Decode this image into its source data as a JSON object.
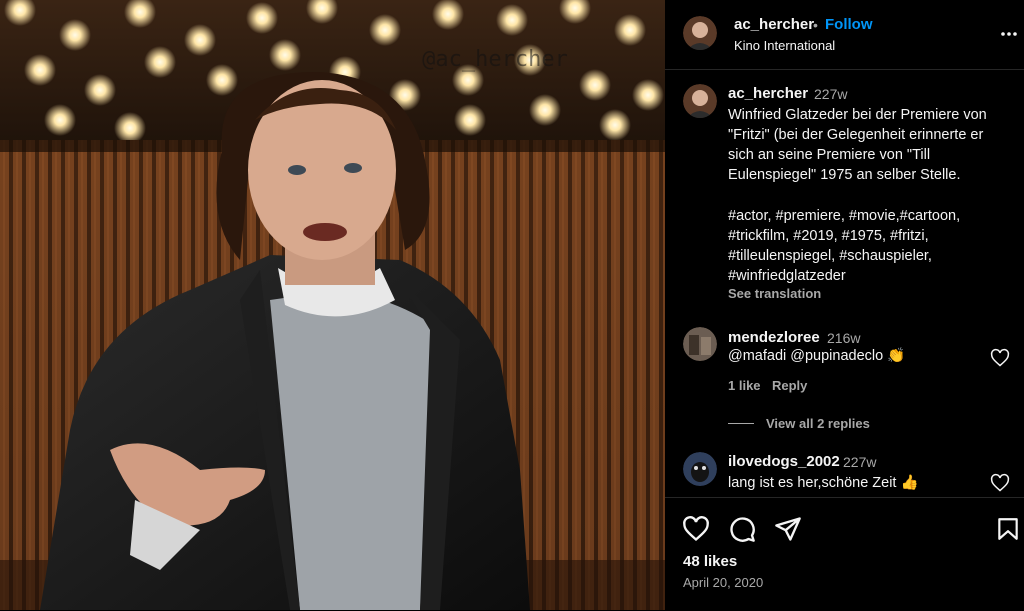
{
  "post": {
    "watermark": "@ac_hercher"
  },
  "header": {
    "username": "ac_hercher",
    "separator": "•",
    "follow_label": "Follow",
    "location": "Kino International",
    "more_icon": "more-horizontal-icon"
  },
  "caption": {
    "username": "ac_hercher",
    "age": "227w",
    "text": "Winfried Glatzeder bei der Premiere von \"Fritzi\" (bei der Gelegenheit erinnerte er sich an seine Premiere von \"Till Eulenspiegel\" 1975 an selber Stelle.",
    "hashtags": "#actor, #premiere, #movie,#cartoon, #trickfilm, #2019, #1975, #fritzi, #tilleulenspiegel, #schauspieler, #winfriedglatzeder",
    "see_translation": "See translation"
  },
  "comments": [
    {
      "username": "mendezloree",
      "age": "216w",
      "text": "@mafadi @pupinadeclo 👏",
      "likes": "1 like",
      "reply": "Reply",
      "view_replies": "View all 2 replies"
    },
    {
      "username": "ilovedogs_2002",
      "age": "227w",
      "text": "lang ist es her,schöne Zeit 👍"
    }
  ],
  "footer": {
    "likes": "48 likes",
    "date": "April 20, 2020"
  },
  "colors": {
    "accent": "#0095f6",
    "muted": "#a8a8a8",
    "divider": "#262626"
  }
}
